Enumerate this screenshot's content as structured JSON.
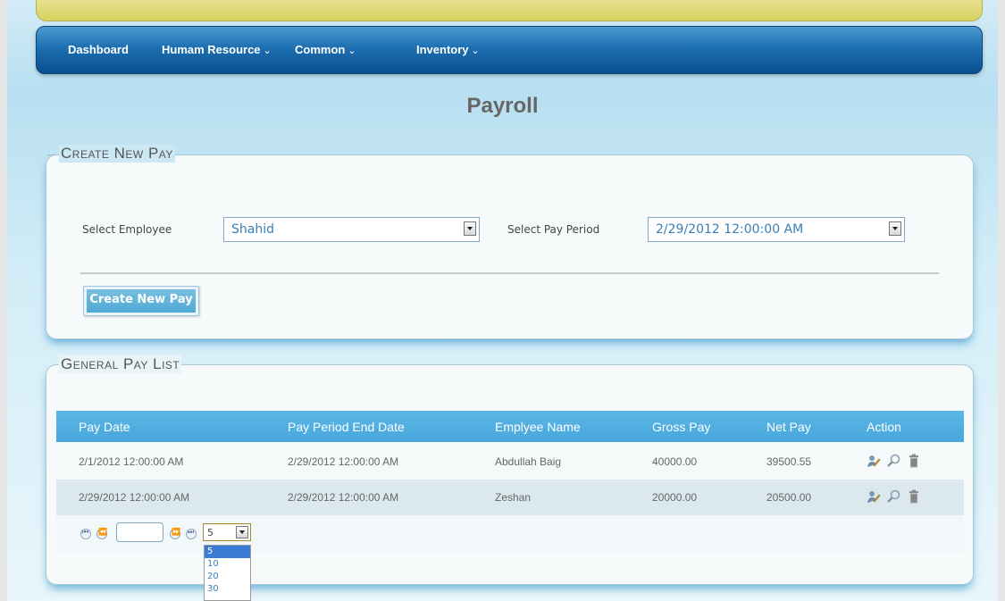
{
  "nav": {
    "items": [
      {
        "label": "Dashboard",
        "has_caret": false
      },
      {
        "label": "Humam Resource",
        "has_caret": true
      },
      {
        "label": "Common",
        "has_caret": true
      },
      {
        "label": "Inventory",
        "has_caret": true
      }
    ],
    "caret": "⌄"
  },
  "page_title": "Payroll",
  "create_panel": {
    "legend": "Create New Pay",
    "employee_label": "Select Employee",
    "employee_value": "Shahid",
    "period_label": "Select Pay Period",
    "period_value": "2/29/2012 12:00:00 AM",
    "button_label": "Create New Pay"
  },
  "list_panel": {
    "legend": "General Pay List",
    "columns": [
      "Pay Date",
      "Pay Period End Date",
      "Emplyee Name",
      "Gross Pay",
      "Net Pay",
      "Action"
    ],
    "rows": [
      {
        "pay_date": "2/1/2012 12:00:00 AM",
        "period_end": "2/29/2012 12:00:00 AM",
        "employee": "Abdullah Baig",
        "gross": "40000.00",
        "net": "39500.55"
      },
      {
        "pay_date": "2/29/2012 12:00:00 AM",
        "period_end": "2/29/2012 12:00:00 AM",
        "employee": "Zeshan",
        "gross": "20000.00",
        "net": "20500.00"
      }
    ],
    "action_icons": [
      "edit-icon",
      "view-icon",
      "delete-icon"
    ]
  },
  "pager": {
    "page_size_value": "5",
    "page_size_options": [
      "5",
      "10",
      "20",
      "30"
    ],
    "page_input_value": ""
  },
  "colors": {
    "nav_blue": "#1d6fb1",
    "header_blue": "#5cb7e6",
    "accent_text": "#3a7fb5"
  }
}
